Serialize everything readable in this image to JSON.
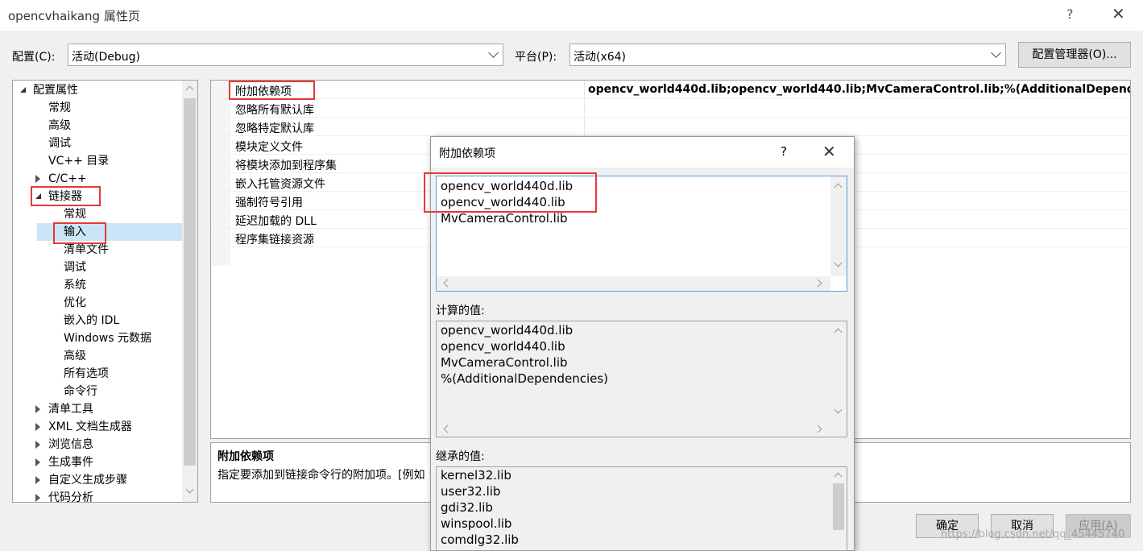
{
  "window": {
    "title": "opencvhaikang 属性页",
    "help": "?",
    "close": "✕"
  },
  "config": {
    "config_label": "配置(C):",
    "config_value": "活动(Debug)",
    "platform_label": "平台(P):",
    "platform_value": "活动(x64)",
    "manager_button": "配置管理器(O)..."
  },
  "tree": [
    {
      "label": "配置属性",
      "indent": 0,
      "expander": "expanded"
    },
    {
      "label": "常规",
      "indent": 1
    },
    {
      "label": "高级",
      "indent": 1
    },
    {
      "label": "调试",
      "indent": 1
    },
    {
      "label": "VC++ 目录",
      "indent": 1
    },
    {
      "label": "C/C++",
      "indent": 1,
      "expander": "collapsed"
    },
    {
      "label": "链接器",
      "indent": 1,
      "expander": "expanded"
    },
    {
      "label": "常规",
      "indent": 2
    },
    {
      "label": "输入",
      "indent": 2,
      "selected": true
    },
    {
      "label": "清单文件",
      "indent": 2
    },
    {
      "label": "调试",
      "indent": 2
    },
    {
      "label": "系统",
      "indent": 2
    },
    {
      "label": "优化",
      "indent": 2
    },
    {
      "label": "嵌入的 IDL",
      "indent": 2
    },
    {
      "label": "Windows 元数据",
      "indent": 2
    },
    {
      "label": "高级",
      "indent": 2
    },
    {
      "label": "所有选项",
      "indent": 2
    },
    {
      "label": "命令行",
      "indent": 2
    },
    {
      "label": "清单工具",
      "indent": 1,
      "expander": "collapsed"
    },
    {
      "label": "XML 文档生成器",
      "indent": 1,
      "expander": "collapsed"
    },
    {
      "label": "浏览信息",
      "indent": 1,
      "expander": "collapsed"
    },
    {
      "label": "生成事件",
      "indent": 1,
      "expander": "collapsed"
    },
    {
      "label": "自定义生成步骤",
      "indent": 1,
      "expander": "collapsed"
    },
    {
      "label": "代码分析",
      "indent": 1,
      "expander": "collapsed"
    }
  ],
  "properties": [
    {
      "name": "附加依赖项",
      "value": "opencv_world440d.lib;opencv_world440.lib;MvCameraControl.lib;%(AdditionalDependencies)"
    },
    {
      "name": "忽略所有默认库",
      "value": ""
    },
    {
      "name": "忽略特定默认库",
      "value": ""
    },
    {
      "name": "模块定义文件",
      "value": ""
    },
    {
      "name": "将模块添加到程序集",
      "value": ""
    },
    {
      "name": "嵌入托管资源文件",
      "value": ""
    },
    {
      "name": "强制符号引用",
      "value": ""
    },
    {
      "name": "延迟加载的 DLL",
      "value": ""
    },
    {
      "name": "程序集链接资源",
      "value": ""
    }
  ],
  "description": {
    "title": "附加依赖项",
    "text": "指定要添加到链接命令行的附加项。[例如"
  },
  "dialog": {
    "title": "附加依赖项",
    "help": "?",
    "close": "✕",
    "edit_lines": [
      "opencv_world440d.lib",
      "opencv_world440.lib",
      "MvCameraControl.lib"
    ],
    "computed_label": "计算的值:",
    "computed_lines": [
      "opencv_world440d.lib",
      "opencv_world440.lib",
      "MvCameraControl.lib",
      "%(AdditionalDependencies)"
    ],
    "inherited_label": "继承的值:",
    "inherited_lines": [
      "kernel32.lib",
      "user32.lib",
      "gdi32.lib",
      "winspool.lib",
      "comdlg32.lib"
    ]
  },
  "buttons": {
    "ok": "确定",
    "cancel": "取消",
    "apply": "应用(A)"
  },
  "watermark": "https://blog.csdn.net/qq_45445740",
  "colors": {
    "highlight_box": "#e53935",
    "selection": "#cce4f7"
  }
}
